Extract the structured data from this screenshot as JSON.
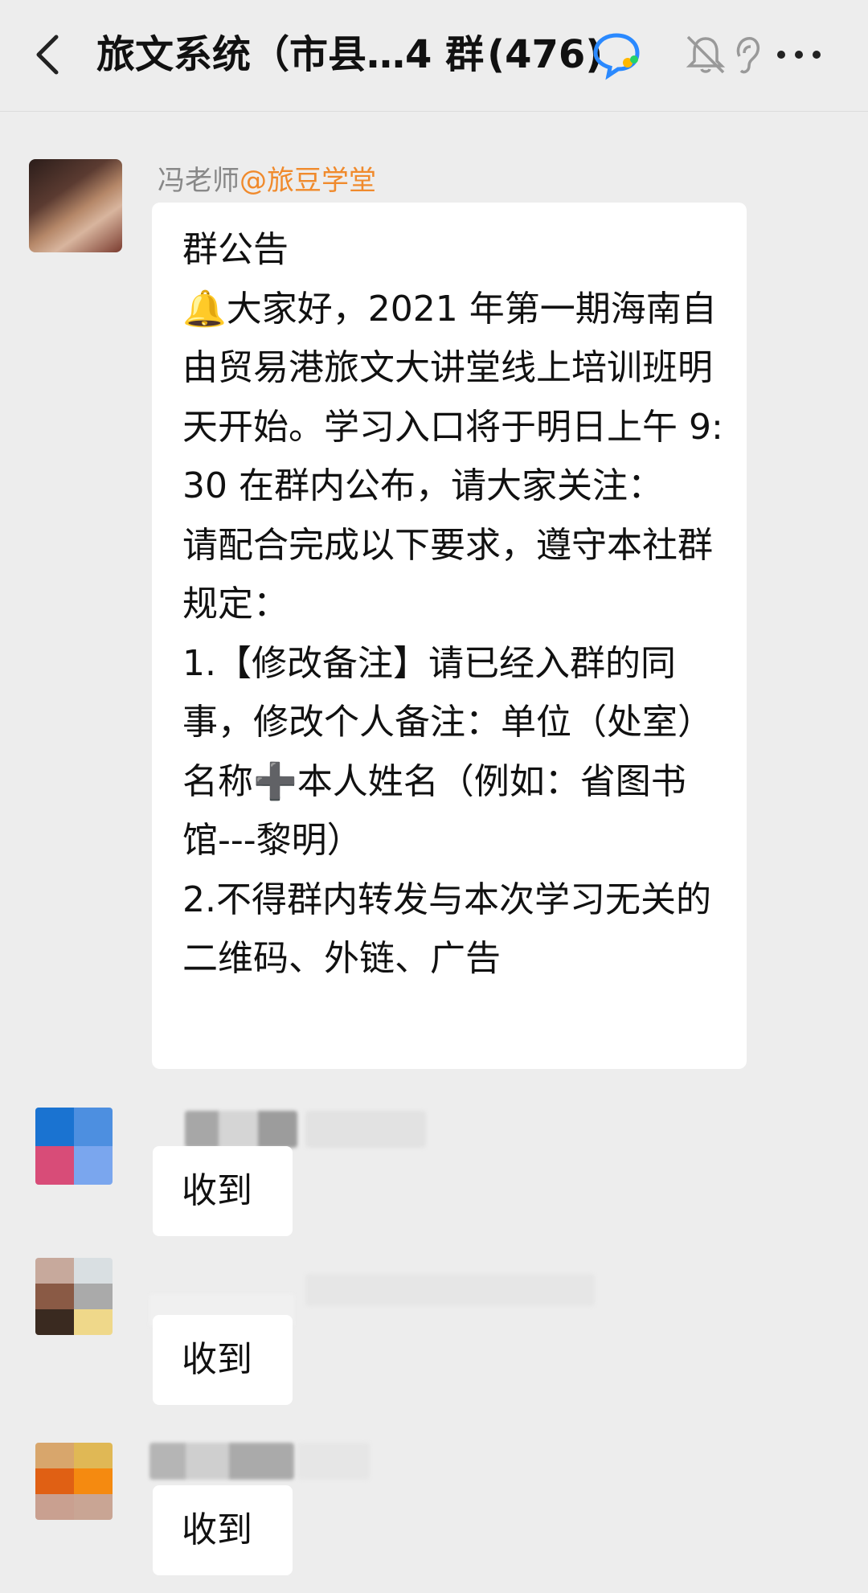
{
  "header": {
    "title": "旅文系统（市县…4 群",
    "member_count": "(476)"
  },
  "announcement": {
    "sender_name": "冯老师",
    "sender_tag": "@旅豆学堂",
    "text": "群公告\n🔔大家好，2021 年第一期海南自由贸易港旅文大讲堂线上培训班明天开始。学习入口将于明日上午 9:30 在群内公布，请大家关注：\n请配合完成以下要求，遵守本社群规定：\n1.【修改备注】请已经入群的同事，修改个人备注：单位（处室）名称➕本人姓名（例如：省图书馆---黎明）\n2.不得群内转发与本次学习无关的二维码、外链、广告"
  },
  "replies": [
    {
      "text": "收到"
    },
    {
      "text": "收到"
    },
    {
      "text": "收到"
    }
  ],
  "colors": {
    "background": "#ededed",
    "bubble": "#ffffff",
    "sender_tag": "#f08a2c",
    "sender_name": "#888888"
  }
}
